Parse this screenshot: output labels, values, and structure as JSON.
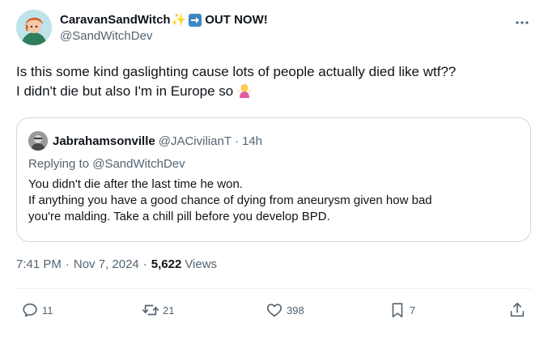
{
  "author": {
    "display_name": "CaravanSandWitch",
    "sparkle_glyph": "✨",
    "out_now": "OUT NOW!",
    "handle": "@SandWitchDev"
  },
  "tweet": {
    "line1": "Is this some kind gaslighting cause lots of people actually died like wtf??",
    "line2": "I didn't die but also I'm in Europe so"
  },
  "quote": {
    "name": "Jabrahamsonville",
    "handle": "@JACivilianT",
    "dot": "·",
    "time": "14h",
    "replying_prefix": "Replying to",
    "replying_to": "@SandWitchDev",
    "line1": "You didn't die after the last time he won.",
    "line2": "If anything you have a good chance of dying from aneurysm given how bad",
    "line3": "you're malding. Take a chill pill before you develop BPD."
  },
  "meta": {
    "time": "7:41 PM",
    "dot1": "·",
    "date": "Nov 7, 2024",
    "dot2": "·",
    "views_count": "5,622",
    "views_label": "Views"
  },
  "actions": {
    "replies": "11",
    "retweets": "21",
    "likes": "398",
    "bookmarks": "7"
  },
  "colors": {
    "text_primary": "#0f1419",
    "text_secondary": "#536471",
    "border": "#cfd9de",
    "arrow_box": "#3b88c3"
  }
}
